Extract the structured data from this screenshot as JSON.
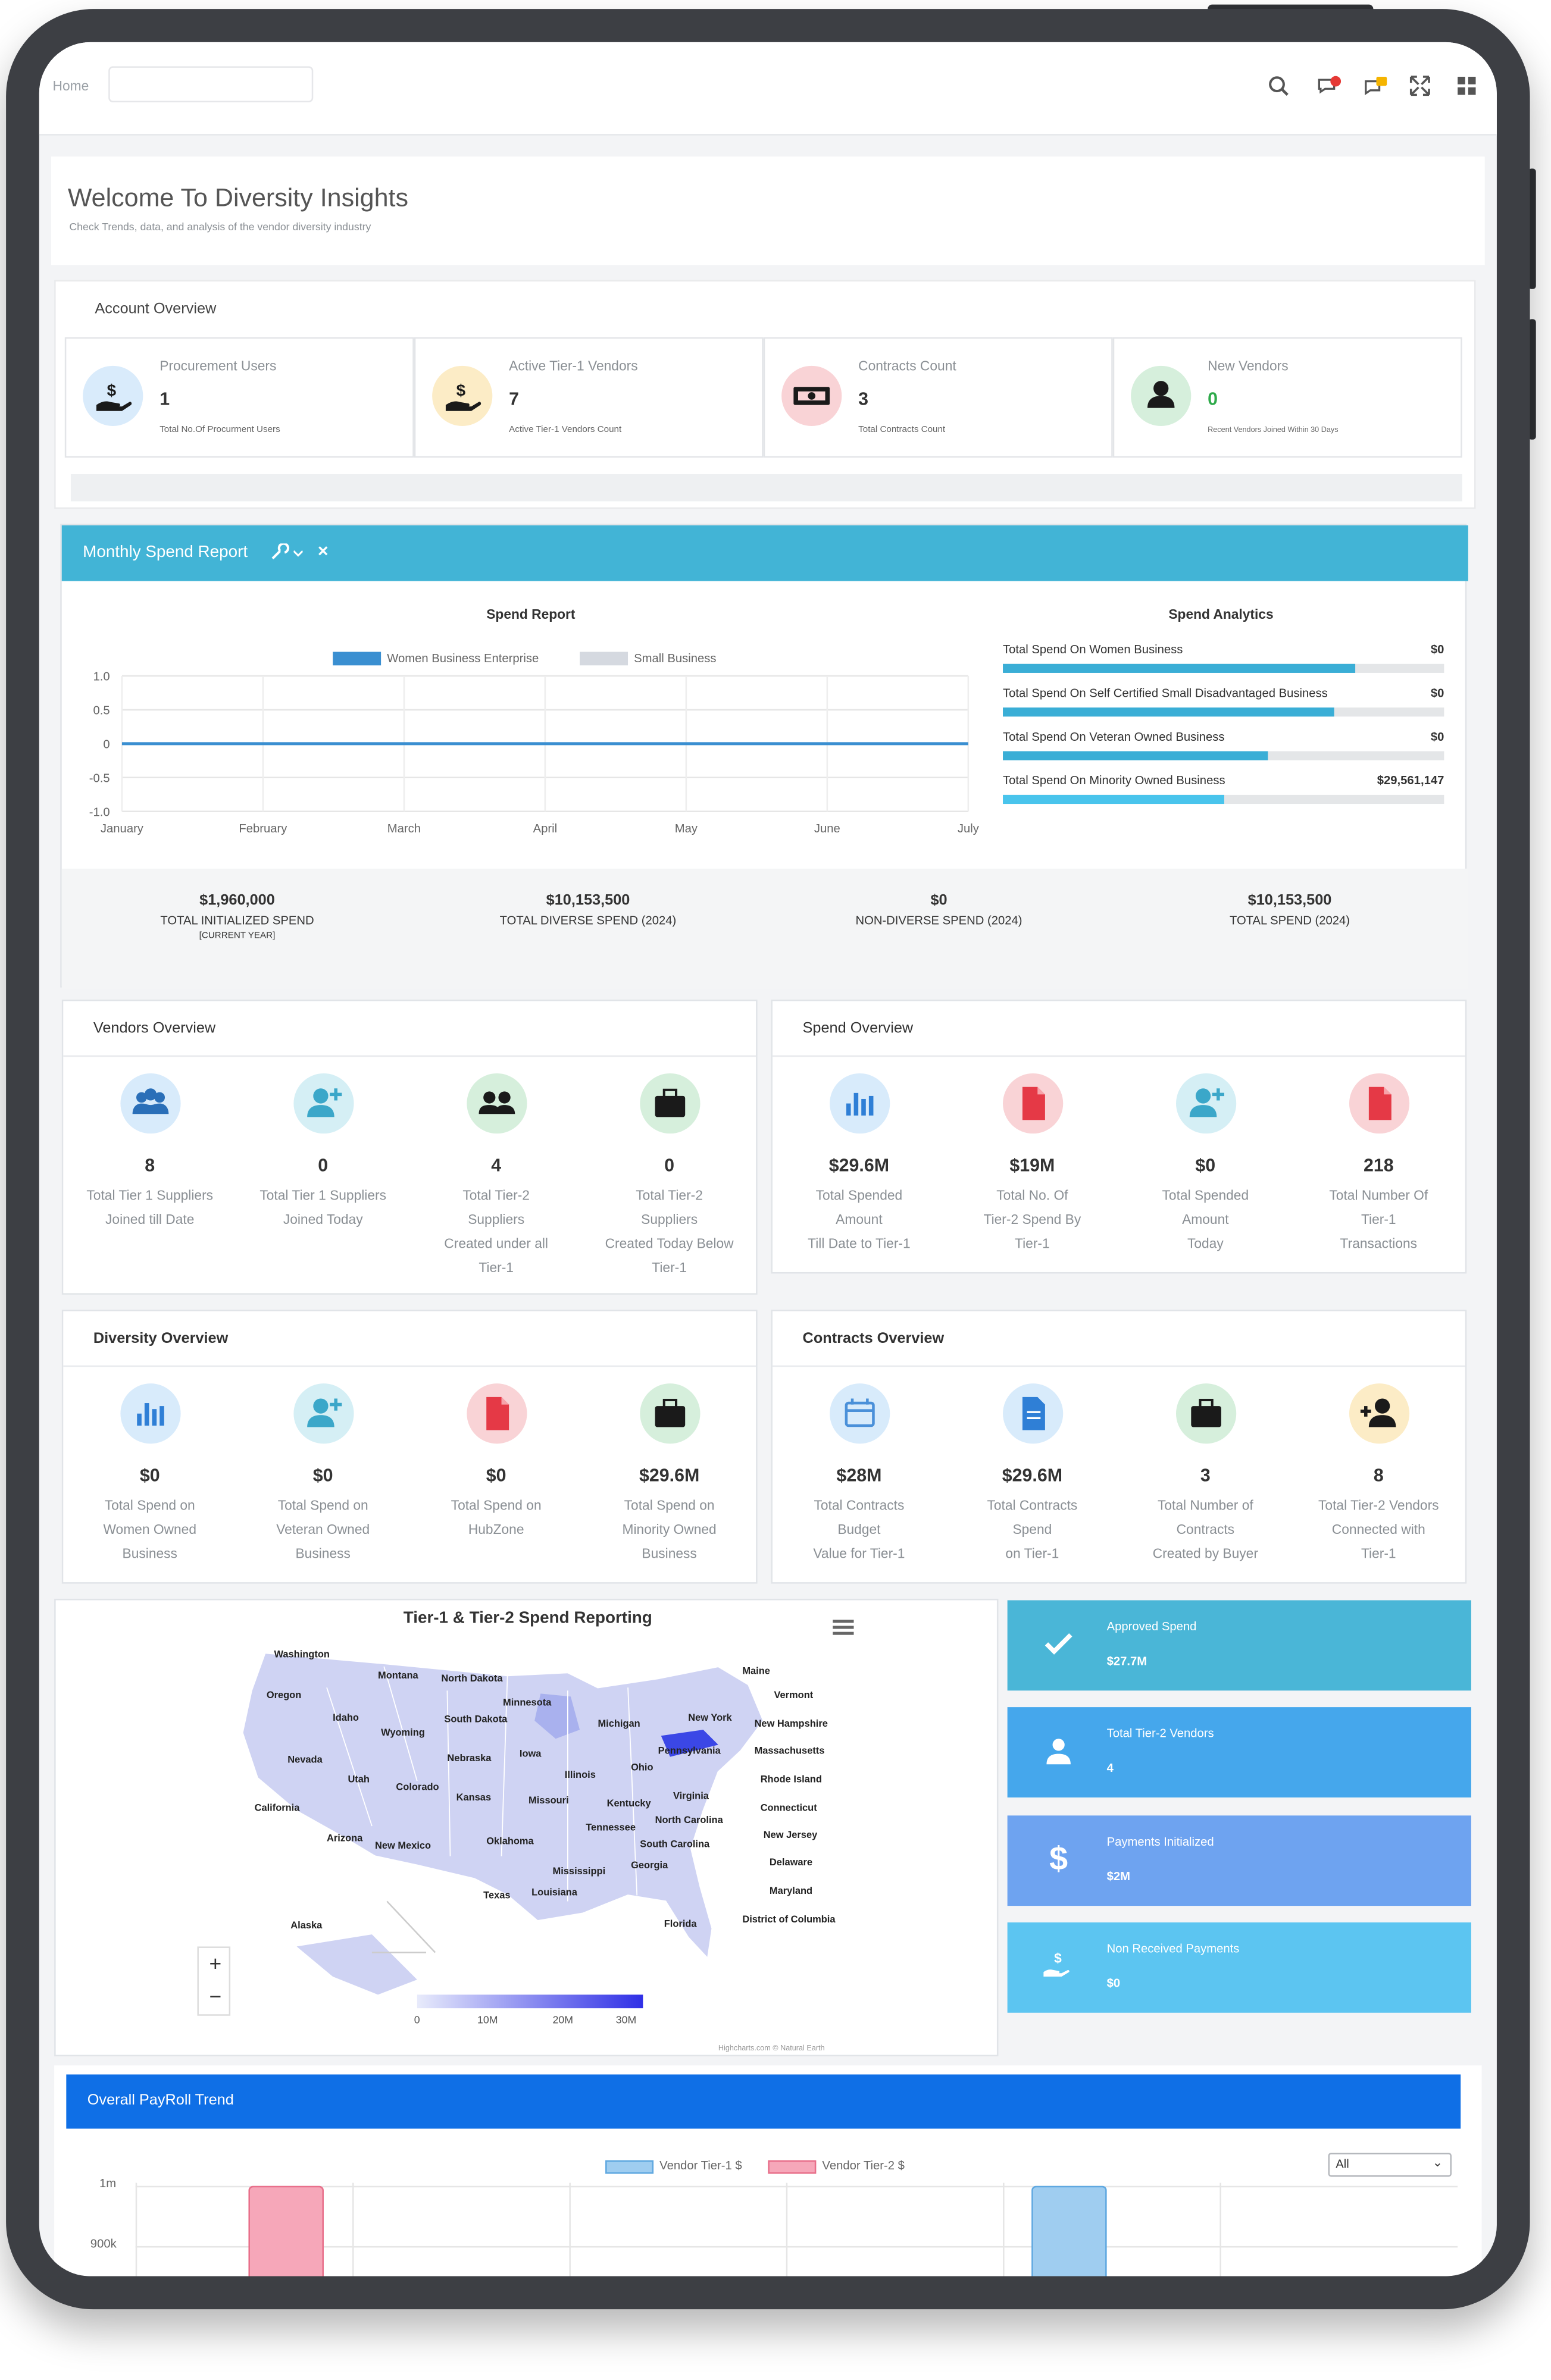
{
  "topbar": {
    "home_label": "Home",
    "icons": [
      "search-icon",
      "chat-icon",
      "notification-icon",
      "fullscreen-icon",
      "apps-grid-icon"
    ]
  },
  "welcome": {
    "title": "Welcome To Diversity Insights",
    "subtitle": "Check Trends, data, and analysis of the vendor diversity industry"
  },
  "account_overview": {
    "title": "Account Overview",
    "cards": [
      {
        "title": "Procurement Users",
        "value": "1",
        "sub": "Total No.Of Procurment Users",
        "icon": "hand-money-icon"
      },
      {
        "title": "Active Tier-1 Vendors",
        "value": "7",
        "sub": "Active Tier-1 Vendors Count",
        "icon": "hand-money-icon"
      },
      {
        "title": "Contracts Count",
        "value": "3",
        "sub": "Total Contracts Count",
        "icon": "money-bill-icon"
      },
      {
        "title": "New Vendors",
        "value": "0",
        "sub": "Recent Vendors Joined Within 30 Days",
        "icon": "user-icon"
      }
    ]
  },
  "monthly_spend": {
    "header": "Monthly Spend Report",
    "close": "×",
    "spend_report_title": "Spend Report",
    "spend_analytics_title": "Spend Analytics",
    "analytics": [
      {
        "label": "Total Spend On Women Business",
        "value": "$0",
        "fill": 0.8
      },
      {
        "label": "Total Spend On Self Certified Small Disadvantaged Business",
        "value": "$0",
        "fill": 0.75
      },
      {
        "label": "Total Spend On Veteran Owned Business",
        "value": "$0",
        "fill": 0.6
      },
      {
        "label": "Total Spend On Minority Owned Business",
        "value": "$29,561,147",
        "fill": 0.5
      }
    ],
    "totals": [
      {
        "value": "$1,960,000",
        "label": "TOTAL INITIALIZED SPEND",
        "sub": "[CURRENT YEAR]"
      },
      {
        "value": "$10,153,500",
        "label": "TOTAL DIVERSE SPEND (2024)",
        "sub": ""
      },
      {
        "value": "$0",
        "label": "NON-DIVERSE SPEND (2024)",
        "sub": ""
      },
      {
        "value": "$10,153,500",
        "label": "TOTAL SPEND (2024)",
        "sub": ""
      }
    ]
  },
  "chart_data": {
    "type": "line",
    "title": "",
    "categories": [
      "January",
      "February",
      "March",
      "April",
      "May",
      "June",
      "July"
    ],
    "y_ticks": [
      "1.0",
      "0.5",
      "0",
      "-0.5",
      "-1.0"
    ],
    "ylim": [
      -1.0,
      1.0
    ],
    "series": [
      {
        "name": "Women Business Enterprise",
        "color": "#3a8fd1",
        "values": [
          0,
          0,
          0,
          0,
          0,
          0,
          0
        ]
      },
      {
        "name": "Small Business",
        "color": "#d5d9e0",
        "values": [
          0,
          0,
          0,
          0,
          0,
          0,
          0
        ]
      }
    ],
    "legend_position": "top"
  },
  "vendors_overview": {
    "title": "Vendors Overview",
    "items": [
      {
        "value": "8",
        "l1": "Total Tier 1 Suppliers",
        "l2": "Joined till Date",
        "l3": "",
        "l4": "",
        "icon": "users-icon"
      },
      {
        "value": "0",
        "l1": "Total Tier 1 Suppliers",
        "l2": "Joined Today",
        "l3": "",
        "l4": "",
        "icon": "user-plus-icon"
      },
      {
        "value": "4",
        "l1": "Total Tier-2",
        "l2": "Suppliers",
        "l3": "Created under all",
        "l4": "Tier-1",
        "icon": "user-group-icon"
      },
      {
        "value": "0",
        "l1": "Total Tier-2",
        "l2": "Suppliers",
        "l3": "Created Today Below",
        "l4": "Tier-1",
        "icon": "briefcase-icon"
      }
    ]
  },
  "spend_overview": {
    "title": "Spend Overview",
    "items": [
      {
        "value": "$29.6M",
        "l1": "Total Spended",
        "l2": "Amount",
        "l3": "Till Date to Tier-1",
        "icon": "bar-chart-icon"
      },
      {
        "value": "$19M",
        "l1": "Total No. Of",
        "l2": "Tier-2 Spend By",
        "l3": "Tier-1",
        "icon": "document-icon"
      },
      {
        "value": "$0",
        "l1": "Total Spended",
        "l2": "Amount",
        "l3": "Today",
        "icon": "user-plus-icon"
      },
      {
        "value": "218",
        "l1": "Total Number Of",
        "l2": "Tier-1",
        "l3": "Transactions",
        "icon": "document-icon"
      }
    ]
  },
  "diversity_overview": {
    "title": "Diversity Overview",
    "items": [
      {
        "value": "$0",
        "l1": "Total Spend on",
        "l2": "Women Owned",
        "l3": "Business",
        "icon": "bar-chart-icon"
      },
      {
        "value": "$0",
        "l1": "Total Spend on",
        "l2": "Veteran Owned",
        "l3": "Business",
        "icon": "user-plus-icon"
      },
      {
        "value": "$0",
        "l1": "Total Spend on",
        "l2": "HubZone",
        "l3": "",
        "icon": "document-icon"
      },
      {
        "value": "$29.6M",
        "l1": "Total Spend on",
        "l2": "Minority Owned",
        "l3": "Business",
        "icon": "briefcase-icon"
      }
    ]
  },
  "contracts_overview": {
    "title": "Contracts Overview",
    "items": [
      {
        "value": "$28M",
        "l1": "Total Contracts",
        "l2": "Budget",
        "l3": "Value for Tier-1",
        "icon": "calendar-icon"
      },
      {
        "value": "$29.6M",
        "l1": "Total Contracts",
        "l2": "Spend",
        "l3": "on Tier-1",
        "icon": "file-icon"
      },
      {
        "value": "3",
        "l1": "Total Number of",
        "l2": "Contracts",
        "l3": "Created by Buyer",
        "icon": "briefcase-icon"
      },
      {
        "value": "8",
        "l1": "Total Tier-2 Vendors",
        "l2": "Connected with",
        "l3": "Tier-1",
        "icon": "user-plus-icon"
      }
    ]
  },
  "map": {
    "title": "Tier-1 & Tier-2 Spend Reporting",
    "credit": "Highcharts.com © Natural Earth",
    "zoom_in": "+",
    "zoom_out": "−",
    "scale_labels": [
      "0",
      "10M",
      "20M",
      "30M"
    ],
    "states": [
      "Washington",
      "Montana",
      "North Dakota",
      "Minnesota",
      "Maine",
      "Oregon",
      "Idaho",
      "South Dakota",
      "Vermont",
      "Wyoming",
      "Michigan",
      "New York",
      "New Hampshire",
      "Nebraska",
      "Iowa",
      "Pennsylvania",
      "Massachusetts",
      "Nevada",
      "Utah",
      "Illinois",
      "Ohio",
      "Rhode Island",
      "Colorado",
      "Kansas",
      "Virginia",
      "California",
      "Missouri",
      "Kentucky",
      "Connecticut",
      "North Carolina",
      "Arizona",
      "Tennessee",
      "New Jersey",
      "New Mexico",
      "Oklahoma",
      "South Carolina",
      "Delaware",
      "Mississippi",
      "Georgia",
      "Texas",
      "Louisiana",
      "Maryland",
      "Alaska",
      "Florida",
      "District of Columbia"
    ]
  },
  "tiles": [
    {
      "title": "Approved Spend",
      "value": "$27.7M",
      "color": "#4ab6d7",
      "icon": "check-icon"
    },
    {
      "title": "Total Tier-2 Vendors",
      "value": "4",
      "color": "#45a7ec",
      "icon": "user-icon"
    },
    {
      "title": "Payments Initialized",
      "value": "$2M",
      "color": "#6ea3f0",
      "icon": "dollar-icon"
    },
    {
      "title": "Non Received Payments",
      "value": "$0",
      "color": "#5cc5f1",
      "icon": "hand-money-icon"
    }
  ],
  "payroll": {
    "header": "Overall PayRoll Trend",
    "legend": [
      "Vendor Tier-1 $",
      "Vendor Tier-2 $"
    ],
    "select_value": "All",
    "y_ticks": [
      "1m",
      "900k"
    ]
  }
}
